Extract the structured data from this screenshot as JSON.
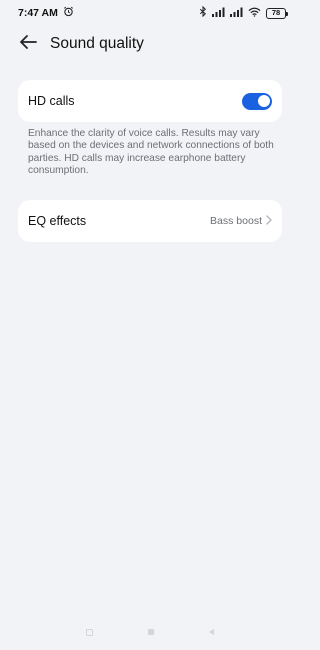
{
  "status_bar": {
    "time": "7:47 AM",
    "battery": "78",
    "icons": [
      "alarm-icon",
      "bluetooth-icon",
      "signal-icon",
      "signal-icon",
      "wifi-icon",
      "battery-icon"
    ]
  },
  "header": {
    "title": "Sound quality",
    "back_icon": "back-arrow-icon"
  },
  "hd_calls": {
    "label": "HD calls",
    "enabled": true,
    "description": "Enhance the clarity of voice calls. Results may vary based on the devices and network connections of both parties. HD calls may increase earphone battery consumption."
  },
  "eq_effects": {
    "label": "EQ effects",
    "value": "Bass boost",
    "chevron_icon": "chevron-right-icon"
  },
  "nav_bar": {
    "icons": [
      "recents-icon",
      "home-icon",
      "back-icon"
    ]
  },
  "colors": {
    "background": "#f2f3f6",
    "card": "#ffffff",
    "accent": "#1a62e0",
    "secondary_text": "#6c6f75"
  }
}
